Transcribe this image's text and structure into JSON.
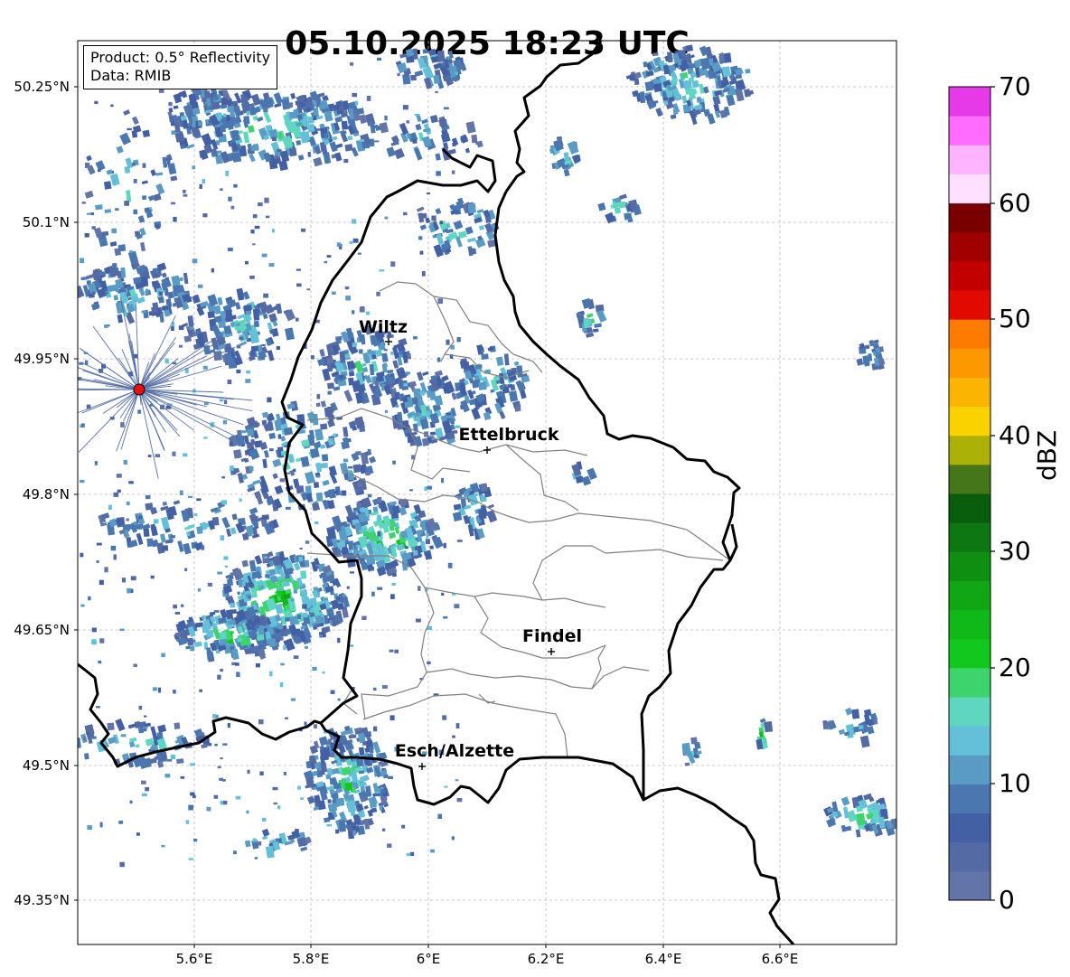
{
  "title": "05.10.2025 18:23 UTC",
  "info": {
    "product": "Product: 0.5° Reflectivity",
    "data": "Data: RMIB"
  },
  "lat_labels": [
    "50.25°N",
    "50.1°N",
    "49.95°N",
    "49.8°N",
    "49.65°N",
    "49.5°N",
    "49.35°N"
  ],
  "lon_labels": [
    "5.6°E",
    "5.8°E",
    "6°E",
    "6.2°E",
    "6.4°E",
    "6.6°E"
  ],
  "cities": [
    "Wiltz",
    "Ettelbruck",
    "Findel",
    "Esch/Alzette"
  ],
  "colorbar": {
    "label": "dBZ",
    "ticks": [
      "70",
      "60",
      "50",
      "40",
      "30",
      "20",
      "10",
      "0"
    ],
    "colors": [
      "#6274a8",
      "#536aa4",
      "#4360a4",
      "#4a77b0",
      "#5a9bc6",
      "#63c0d8",
      "#5ed6c0",
      "#3dd46d",
      "#12c81e",
      "#10b818",
      "#10a614",
      "#0f8f12",
      "#0d7712",
      "#095e0e",
      "#46761a",
      "#acb108",
      "#fad200",
      "#fbb500",
      "#fd9800",
      "#fd7c00",
      "#e20a00",
      "#c20000",
      "#a00000",
      "#7a0000",
      "#ffe0ff",
      "#ffb4ff",
      "#ff6cff",
      "#e63ae9"
    ]
  }
}
